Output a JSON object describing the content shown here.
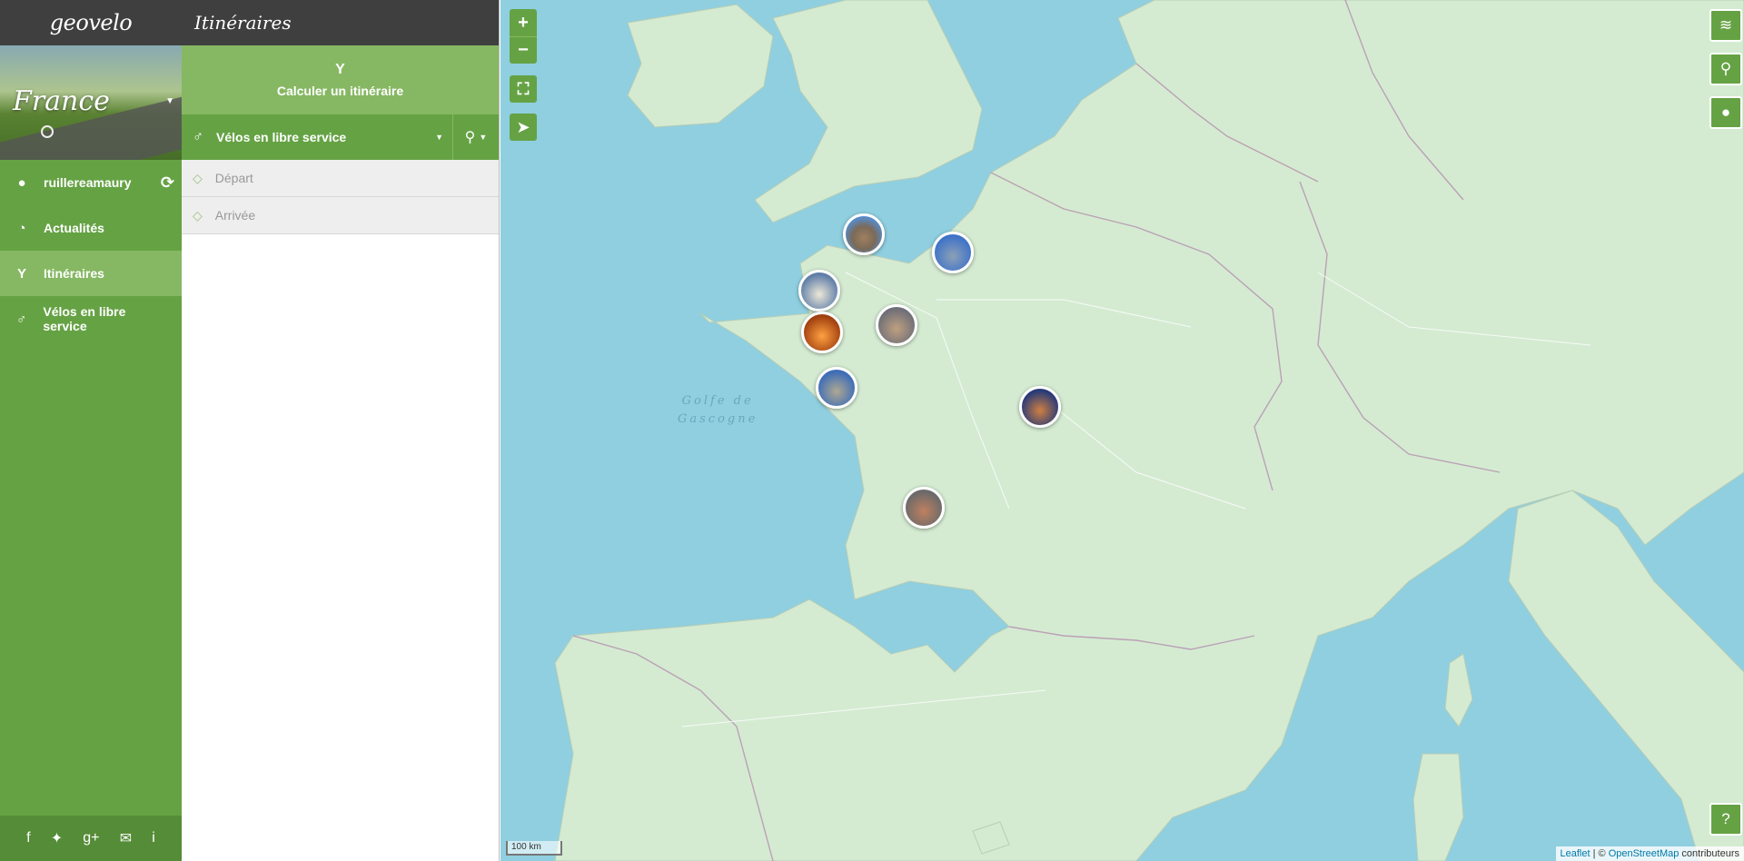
{
  "brand": {
    "logo_text": "geovelo"
  },
  "region": {
    "name": "France"
  },
  "nav": {
    "items": [
      {
        "label": "ruillereamaury",
        "icon": "user-icon"
      },
      {
        "label": "Actualités",
        "icon": "rss-icon"
      },
      {
        "label": "Itinéraires",
        "icon": "route-icon",
        "active": true
      },
      {
        "label": "Vélos en libre service",
        "icon": "bike-share-icon"
      }
    ],
    "social": [
      "f",
      "t",
      "g+",
      "mail",
      "i"
    ]
  },
  "panel": {
    "title": "Itinéraires",
    "calc_label": "Calculer un itinéraire",
    "mode_label": "Vélos en libre service",
    "departure_placeholder": "Départ",
    "arrival_placeholder": "Arrivée"
  },
  "map": {
    "sea_labels": [
      "Golfe de",
      "Gascogne"
    ],
    "scale_label": "100 km",
    "attribution": {
      "leaflet": "Leaflet",
      "sep": " | © ",
      "osm": "OpenStreetMap",
      "suffix": " contributeurs"
    },
    "help_label": "?"
  },
  "colors": {
    "primary_green": "#65a244",
    "light_green": "#86b863",
    "dark_header": "#3f3f3f",
    "sea": "#8fcfe0",
    "land": "#d4ebd2"
  }
}
